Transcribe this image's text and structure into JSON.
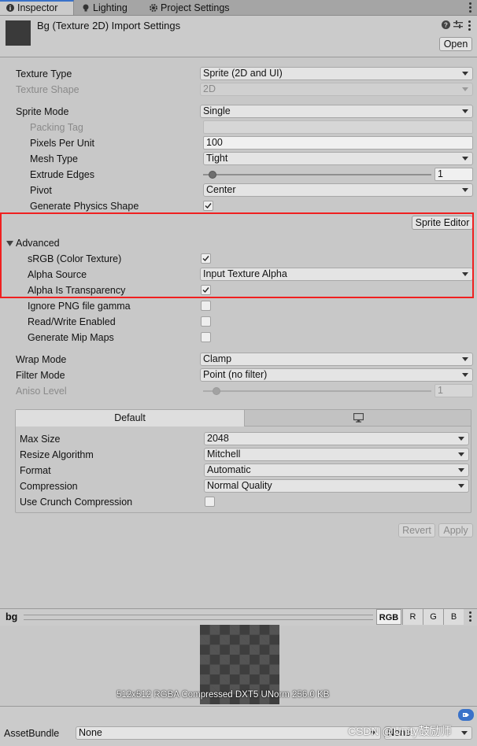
{
  "tabs": [
    {
      "label": "Inspector",
      "icon": "info-icon",
      "active": true
    },
    {
      "label": "Lighting",
      "icon": "lightbulb-icon",
      "active": false
    },
    {
      "label": "Project Settings",
      "icon": "gear-icon",
      "active": false
    }
  ],
  "header": {
    "title": "Bg (Texture 2D) Import Settings",
    "open_label": "Open",
    "icons": [
      "help-icon",
      "presets-icon",
      "more-icon"
    ]
  },
  "texture_type": {
    "label": "Texture Type",
    "value": "Sprite (2D and UI)"
  },
  "texture_shape": {
    "label": "Texture Shape",
    "value": "2D"
  },
  "sprite_mode": {
    "label": "Sprite Mode",
    "value": "Single"
  },
  "packing_tag": {
    "label": "Packing Tag",
    "value": ""
  },
  "pixels_per_unit": {
    "label": "Pixels Per Unit",
    "value": "100"
  },
  "mesh_type": {
    "label": "Mesh Type",
    "value": "Tight"
  },
  "extrude_edges": {
    "label": "Extrude Edges",
    "value": "1",
    "slider_fraction": 0.04
  },
  "pivot": {
    "label": "Pivot",
    "value": "Center"
  },
  "generate_physics_shape": {
    "label": "Generate Physics Shape",
    "checked": true
  },
  "sprite_editor_label": "Sprite Editor",
  "advanced": {
    "label": "Advanced",
    "srgb": {
      "label": "sRGB (Color Texture)",
      "checked": true
    },
    "alpha_source": {
      "label": "Alpha Source",
      "value": "Input Texture Alpha"
    },
    "alpha_is_transparency": {
      "label": "Alpha Is Transparency",
      "checked": true
    },
    "ignore_png_gamma": {
      "label": "Ignore PNG file gamma",
      "checked": false
    },
    "read_write": {
      "label": "Read/Write Enabled",
      "checked": false
    },
    "mip_maps": {
      "label": "Generate Mip Maps",
      "checked": false
    }
  },
  "wrap_mode": {
    "label": "Wrap Mode",
    "value": "Clamp"
  },
  "filter_mode": {
    "label": "Filter Mode",
    "value": "Point (no filter)"
  },
  "aniso_level": {
    "label": "Aniso Level",
    "value": "1",
    "slider_fraction": 0.06
  },
  "platform": {
    "default_tab": "Default",
    "second_tab_icon": "monitor-icon",
    "max_size": {
      "label": "Max Size",
      "value": "2048"
    },
    "resize_algorithm": {
      "label": "Resize Algorithm",
      "value": "Mitchell"
    },
    "format": {
      "label": "Format",
      "value": "Automatic"
    },
    "compression": {
      "label": "Compression",
      "value": "Normal Quality"
    },
    "use_crunch": {
      "label": "Use Crunch Compression",
      "checked": false
    }
  },
  "revert_label": "Revert",
  "apply_label": "Apply",
  "preview": {
    "name": "bg",
    "channels": [
      "RGB",
      "R",
      "G",
      "B"
    ],
    "info": "512x512  RGBA Compressed DXT5 UNorm   256.0 KB"
  },
  "asset_bundle": {
    "label": "AssetBundle",
    "value": "None",
    "variant": "None"
  },
  "watermark": "CSDN @Unity鼓励师",
  "colors": {
    "accent": "#3a72c9",
    "highlight": "#f02020"
  }
}
